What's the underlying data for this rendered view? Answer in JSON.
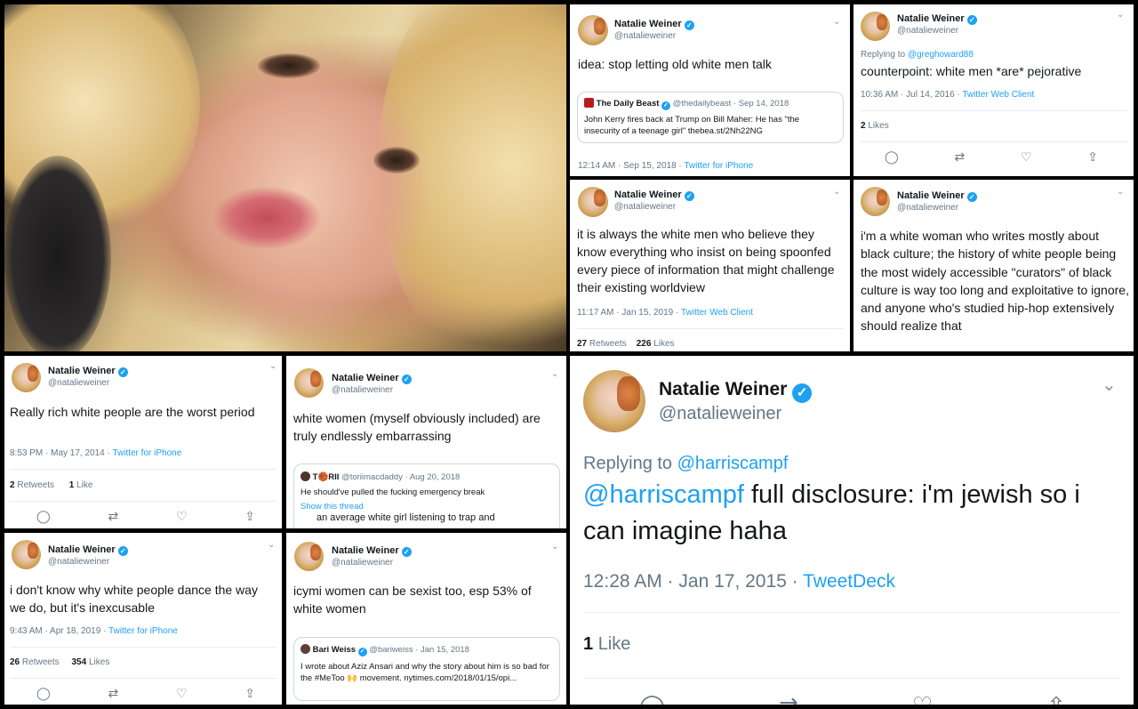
{
  "profile": {
    "name": "Natalie Weiner",
    "handle": "@natalieweiner",
    "verified_color": "#1da1f2"
  },
  "tweets": {
    "t1": {
      "text": "idea: stop letting old white men talk",
      "quote": {
        "name": "The Daily Beast",
        "handle": "@thedailybeast",
        "date": "· Sep 14, 2018",
        "text": "John Kerry fires back at Trump on Bill Maher: He has \"the insecurity of a teenage girl\" thebea.st/2Nh22NG"
      },
      "time": "12:14 AM · Sep 15, 2018 · ",
      "client": "Twitter for iPhone"
    },
    "t2": {
      "replying_prefix": "Replying to ",
      "replying_to": "@greghoward88",
      "text": "counterpoint: white men *are* pejorative",
      "time": "10:36 AM · Jul 14, 2016 · ",
      "client": "Twitter Web Client",
      "likes_count": "2",
      "likes_label": "Likes"
    },
    "t3": {
      "text": "it is always the white men who believe they know everything who insist on being spoonfed every piece of information that might challenge their existing worldview",
      "time": "11:17 AM · Jan 15, 2019 · ",
      "client": "Twitter Web Client",
      "retweets_count": "27",
      "retweets_label": "Retweets",
      "likes_count": "226",
      "likes_label": "Likes"
    },
    "t4": {
      "text": "i'm a white woman who writes mostly about black culture; the history of white people being the most widely accessible \"curators\" of black culture is  way too long and exploitative to ignore, and anyone who's studied hip-hop extensively should realize that"
    },
    "t5": {
      "text": "Really rich white people are the worst period",
      "time": "8:53 PM · May 17, 2014 · ",
      "client": "Twitter for iPhone",
      "retweets_count": "2",
      "retweets_label": "Retweets",
      "likes_count": "1",
      "likes_label": "Like"
    },
    "t6": {
      "text": "white women (myself obviously included) are truly endlessly embarrassing",
      "quote": {
        "name": "T🏀RII",
        "handle": "@toriimacdaddy",
        "date": "· Aug 20, 2018",
        "text": "He should've pulled the fucking emergency break",
        "show_thread": "Show this thread",
        "cut_text": "an average white girl listening to trap and"
      }
    },
    "t7": {
      "text": "i don't know why white people dance the way we do, but it's inexcusable",
      "time": "9:43 AM · Apr 18, 2019 · ",
      "client": "Twitter for iPhone",
      "retweets_count": "26",
      "retweets_label": "Retweets",
      "likes_count": "354",
      "likes_label": "Likes"
    },
    "t8": {
      "text": "icymi women can be sexist too, esp 53% of white women",
      "quote": {
        "name": "Bari Weiss",
        "handle": "@bariweiss",
        "date": "· Jan 15, 2018",
        "text": "I wrote about Aziz Ansari and why the story about him is so bad for the #MeToo 🙌 movement. nytimes.com/2018/01/15/opi..."
      }
    },
    "t9": {
      "replying_prefix": "Replying to ",
      "replying_to": "@harriscampf",
      "mention": "@harriscampf",
      "text": " full disclosure: i'm jewish so i can imagine haha",
      "time": "12:28 AM · Jan 17, 2015 · ",
      "client": "TweetDeck",
      "likes_count": "1",
      "likes_label": "Like"
    }
  },
  "icons": {
    "reply": "reply-icon",
    "retweet": "retweet-icon",
    "like": "heart-icon",
    "share": "share-icon",
    "chevron": "chevron-down-icon",
    "verified": "verified-badge-icon"
  }
}
